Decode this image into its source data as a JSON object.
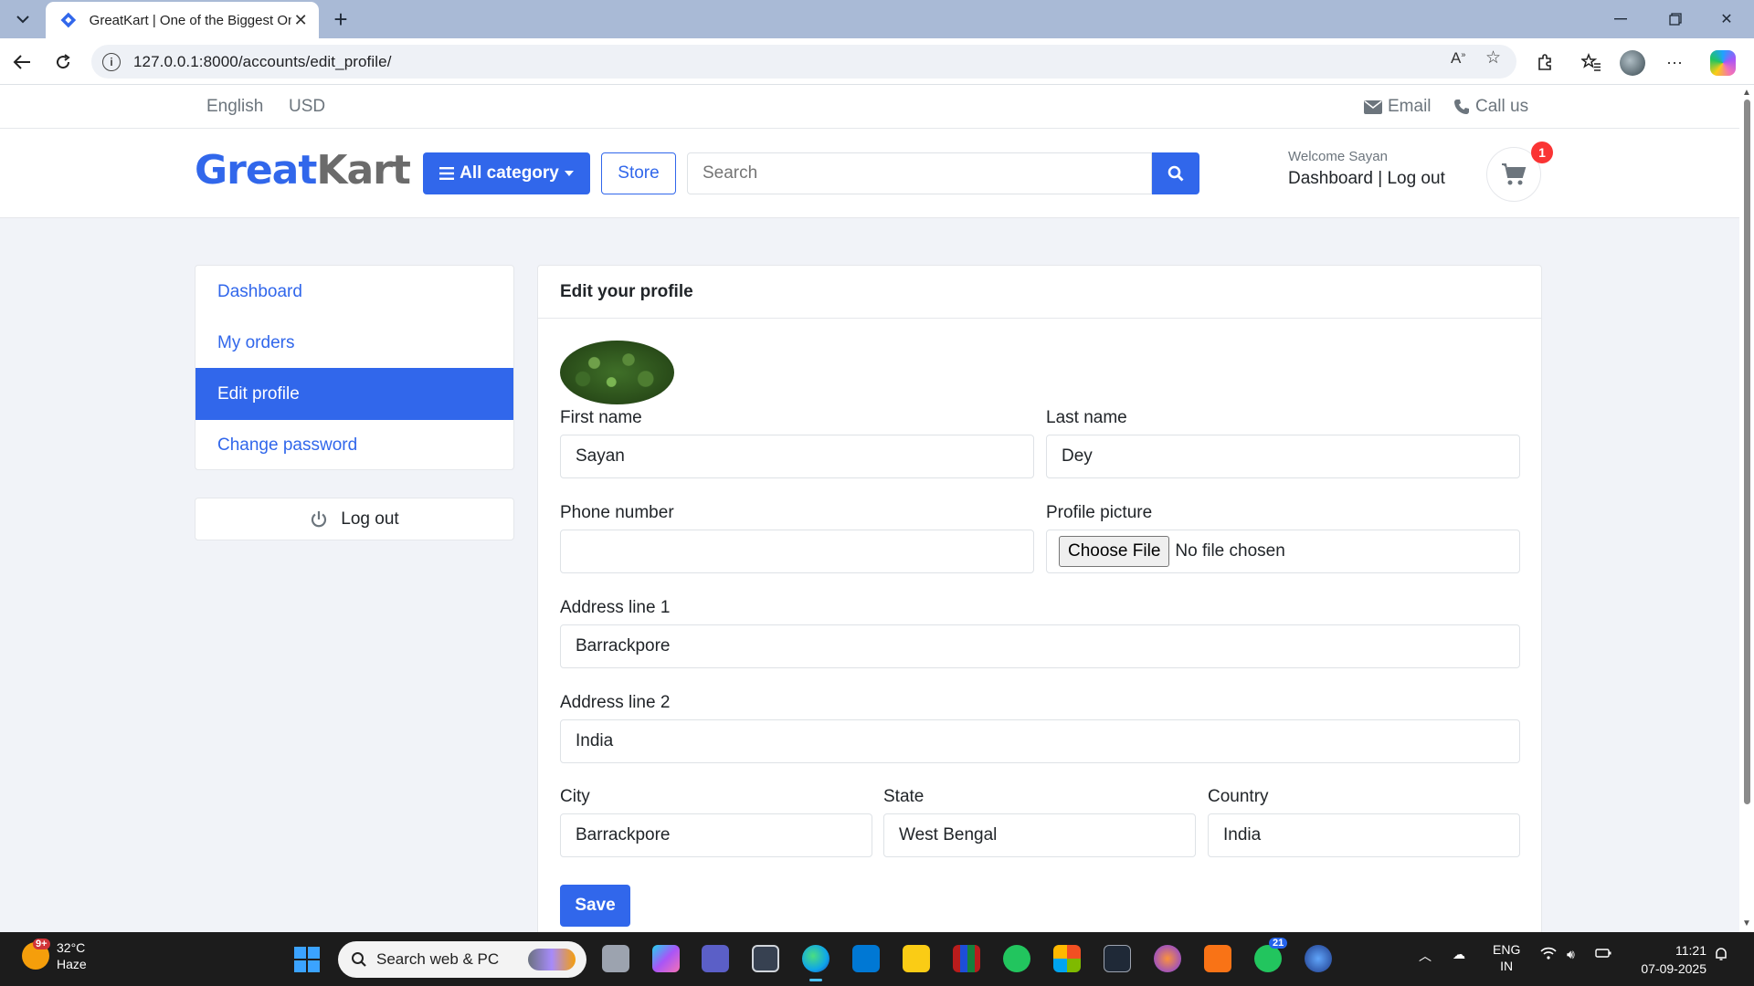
{
  "browser": {
    "tab_title": "GreatKart | One of the Biggest Online Shopping Platform",
    "url": "127.0.0.1:8000/accounts/edit_profile/"
  },
  "topbar": {
    "language": "English",
    "currency": "USD",
    "email": "Email",
    "call": "Call us"
  },
  "header": {
    "logo_part1": "Great",
    "logo_part2": "Kart",
    "category_label": "All category",
    "store_label": "Store",
    "search_placeholder": "Search",
    "welcome": "Welcome Sayan",
    "dashboard_link": "Dashboard",
    "separator": "|",
    "logout_link": "Log out",
    "cart_count": "1"
  },
  "sidebar": {
    "items": [
      {
        "label": "Dashboard",
        "active": false
      },
      {
        "label": "My orders",
        "active": false
      },
      {
        "label": "Edit profile",
        "active": true
      },
      {
        "label": "Change password",
        "active": false
      }
    ],
    "logout_label": "Log out"
  },
  "form": {
    "title": "Edit your profile",
    "first_name_label": "First name",
    "first_name": "Sayan",
    "last_name_label": "Last name",
    "last_name": "Dey",
    "phone_label": "Phone number",
    "phone": "",
    "picture_label": "Profile picture",
    "file_button": "Choose File",
    "file_status": "No file chosen",
    "address1_label": "Address line 1",
    "address1": "Barrackpore",
    "address2_label": "Address line 2",
    "address2": "India",
    "city_label": "City",
    "city": "Barrackpore",
    "state_label": "State",
    "state": "West Bengal",
    "country_label": "Country",
    "country": "India",
    "save_label": "Save"
  },
  "taskbar": {
    "weather_temp": "32°C",
    "weather_desc": "Haze",
    "weather_badge": "9+",
    "search_label": "Search web & PC",
    "lang_line1": "ENG",
    "lang_line2": "IN",
    "time": "11:21",
    "date": "07-09-2025",
    "whatsapp_badge": "21"
  },
  "colors": {
    "primary": "#3167eb",
    "badge": "#fa3434"
  }
}
